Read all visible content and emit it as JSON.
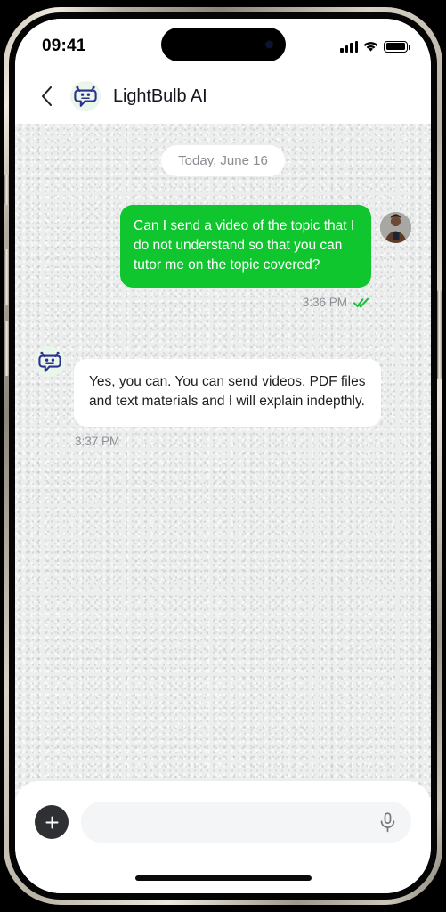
{
  "status_bar": {
    "time": "09:41",
    "signal_icon": "cellular-signal-icon",
    "wifi_icon": "wifi-icon",
    "battery_icon": "battery-full-icon"
  },
  "header": {
    "back_icon": "chevron-left-icon",
    "avatar_icon": "bot-avatar-icon",
    "title": "LightBulb AI"
  },
  "chat": {
    "date_divider": "Today, June 16",
    "messages": [
      {
        "id": "outgoing-1",
        "direction": "outgoing",
        "text": "Can I send a video of the topic that I do not understand so that you can tutor me on the topic covered?",
        "time": "3:36 PM",
        "status": "read",
        "status_icon": "double-check-icon",
        "avatar": "user-photo-avatar"
      },
      {
        "id": "incoming-1",
        "direction": "incoming",
        "text": "Yes, you can. You can send videos, PDF files and text materials and I will explain indepthly.",
        "time": "3:37 PM",
        "avatar": "bot-avatar-icon"
      }
    ]
  },
  "composer": {
    "attach_icon": "plus-icon",
    "attach_label": "+",
    "input_value": "",
    "input_placeholder": "",
    "mic_icon": "microphone-icon"
  },
  "system": {
    "home_indicator": "home-indicator-bar"
  },
  "colors": {
    "outgoing_bubble": "#0fc62e",
    "incoming_bubble": "#ffffff",
    "chat_background": "#eceded",
    "bot_accent": "#2f2f8f",
    "bot_avatar_bg": "#e8f7ea",
    "attach_button": "#2f3033",
    "read_receipt": "#18c23a"
  }
}
